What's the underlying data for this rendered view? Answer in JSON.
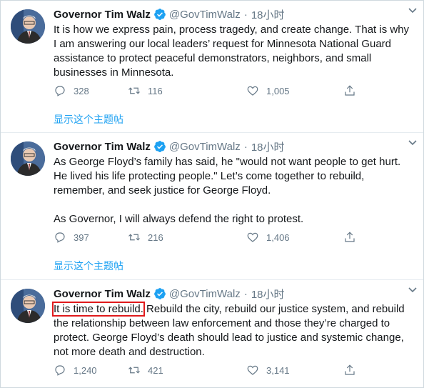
{
  "colors": {
    "accent": "#1da1f2",
    "text": "#14171a",
    "muted": "#657786",
    "highlight": "#e0191b"
  },
  "tweets": [
    {
      "name": "Governor Tim Walz",
      "handle": "@GovTimWalz",
      "separator": "·",
      "time": "18小时",
      "paragraphs": [
        "It is how we express pain, process tragedy, and create change. That is why I am answering our local leaders’ request for Minnesota National Guard assistance to protect peaceful demonstrators, neighbors, and small businesses in Minnesota."
      ],
      "replies": "328",
      "retweets": "116",
      "likes": "1,005",
      "show_thread": "显示这个主题帖"
    },
    {
      "name": "Governor Tim Walz",
      "handle": "@GovTimWalz",
      "separator": "·",
      "time": "18小时",
      "paragraphs": [
        "As George Floyd’s family has said, he \"would not want people to get hurt. He lived his life protecting people.\" Let’s come together to rebuild, remember, and seek justice for George Floyd.",
        "As Governor, I will always defend the right to protest."
      ],
      "replies": "397",
      "retweets": "216",
      "likes": "1,406",
      "show_thread": "显示这个主题帖"
    },
    {
      "name": "Governor Tim Walz",
      "handle": "@GovTimWalz",
      "separator": "·",
      "time": "18小时",
      "highlight": "It is time to rebuild.",
      "rest": " Rebuild the city, rebuild our justice system, and rebuild the relationship between law enforcement and those they’re charged to protect. George Floyd’s death should lead to justice and systemic change, not more death and destruction.",
      "replies": "1,240",
      "retweets": "421",
      "likes": "3,141"
    }
  ]
}
